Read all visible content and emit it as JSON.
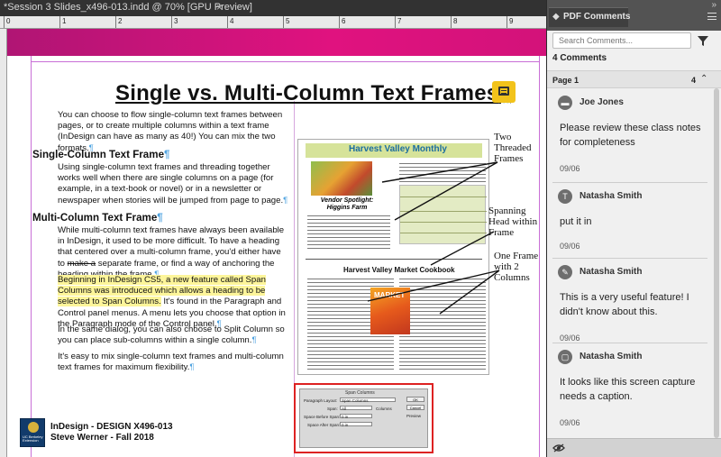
{
  "document": {
    "tab_title": "*Session 3 Slides_x496-013.indd @ 70% [GPU Preview]",
    "close_glyph": "×",
    "ruler_labels": [
      "0",
      "1",
      "2",
      "3",
      "4",
      "5",
      "6",
      "7",
      "8",
      "9"
    ]
  },
  "slide": {
    "title": "Single vs. Multi-Column Text Frames",
    "intro": "You can choose to flow single-column text frames between pages, or to create multiple columns within a text frame (InDesign can have as many as 40!) You can mix the two formats.",
    "single_heading": "Single-Column Text Frame",
    "single_body": "Using single-column text frames and threading together works well when there are single columns on a page (for example, in a text-book or novel) or in a newsletter or newspaper when stories will be jumped from page to page.",
    "multi_heading": "Multi-Column Text Frame",
    "multi_body_pre": "While multi-column text frames have always been available in InDesign, it used to be more difficult. To have a heading that centered over a multi-column frame, you'd either have to ",
    "multi_body_strike": "make a",
    "multi_body_post": " separate frame, or find a way of anchoring the heading within the frame.",
    "span_highlight": "Beginning in InDesign CS5, a new feature called Span Columns was introduced which allows a heading to be selected to Span Columns.",
    "span_rest": " It's found in the Paragraph and Control panel menus. A menu lets you choose that option in the Paragraph mode of the Control panel.",
    "split_body": "In the same dialog, you can also choose to Split Column so you can place sub-columns within a single column.",
    "easy_body": "It's easy to mix single-column text frames and multi-column text frames for maximum flexibility.",
    "pilcrow": "¶"
  },
  "newsletter": {
    "masthead": "Harvest Valley Monthly",
    "vendor": "Vendor Spotlight: Higgins Farm",
    "cookbook_title": "Harvest Valley Market Cookbook",
    "cookbook_cover": "MARKET"
  },
  "callouts": {
    "threaded": "Two Threaded Frames",
    "spanning": "Spanning Head within Frame",
    "one_frame": "One Frame with 2 Columns"
  },
  "dialog": {
    "title": "Span Columns",
    "layout_label": "Paragraph Layout:",
    "layout_value": "Span Columns",
    "span_label": "Span:",
    "span_value": "All",
    "columns_label": "Columns",
    "before_label": "Space Before Span:",
    "before_value": "0 in",
    "after_label": "Space After Span:",
    "after_value": "0 in",
    "ok": "OK",
    "cancel": "Cancel",
    "preview": "Preview"
  },
  "footer": {
    "line1": "InDesign - DESIGN X496-013",
    "line2": "Steve Werner - Fall 2018",
    "logo_text": "UC Berkeley Extension"
  },
  "panel": {
    "tab_label": "PDF Comments",
    "search_placeholder": "Search Comments...",
    "count_label": "4 Comments",
    "page_label": "Page 1",
    "page_count": "4",
    "comments": [
      {
        "author": "Joe Jones",
        "icon": "comment-icon",
        "glyph": "▬",
        "text": "Please review these class notes for completeness",
        "date": "09/06"
      },
      {
        "author": "Natasha Smith",
        "icon": "text-insert-icon",
        "glyph": "T",
        "text": "put it in",
        "date": "09/06"
      },
      {
        "author": "Natasha Smith",
        "icon": "pencil-icon",
        "glyph": "✎",
        "text": "This is a very useful feature! I didn't know about this.",
        "date": "09/06"
      },
      {
        "author": "Natasha Smith",
        "icon": "rectangle-icon",
        "glyph": "▢",
        "text": "It looks like this screen capture needs a caption.",
        "date": "09/06"
      }
    ]
  },
  "colors": {
    "bleed": "#e0127f",
    "highlight": "#fdf59a",
    "comment_badge": "#f2c31b",
    "dialog_outline": "#dd2222",
    "pilcrow": "#4fa3e0"
  }
}
